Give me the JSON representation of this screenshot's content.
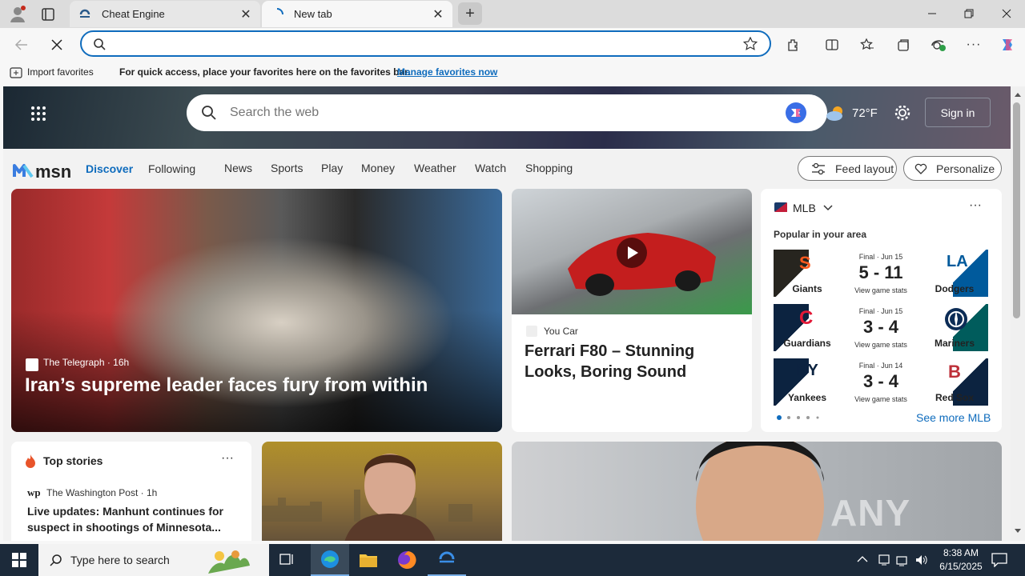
{
  "browser": {
    "tabs": [
      {
        "title": "Cheat Engine"
      },
      {
        "title": "New tab"
      }
    ],
    "address_value": "",
    "favorites_bar": {
      "import_label": "Import favorites",
      "hint": "For quick access, place your favorites here on the favorites bar.",
      "manage_link": "Manage favorites now"
    }
  },
  "msn": {
    "search_placeholder": "Search the web",
    "weather_temp": "72°F",
    "sign_in": "Sign in",
    "logo_text": "msn",
    "tabs": [
      "Discover",
      "Following"
    ],
    "nav": [
      "News",
      "Sports",
      "Play",
      "Money",
      "Weather",
      "Watch",
      "Shopping"
    ],
    "feed_layout": "Feed layout",
    "personalize": "Personalize",
    "hero_story": {
      "source": "The Telegraph",
      "age": "16h",
      "headline": "Iran’s supreme leader faces fury from within"
    },
    "video_story": {
      "source": "You Car",
      "headline": "Ferrari F80 – Stunning Looks, Boring Sound"
    },
    "mlb": {
      "title": "MLB",
      "subtitle": "Popular in your area",
      "games": [
        {
          "status": "Final · Jun 15",
          "score": "5 - 11",
          "home": "Giants",
          "away": "Dodgers",
          "link": "View game stats",
          "home_color": "#27251f",
          "away_color": "#005a9c"
        },
        {
          "status": "Final · Jun 15",
          "score": "3 - 4",
          "home": "Guardians",
          "away": "Mariners",
          "link": "View game stats",
          "home_color": "#0c2340",
          "away_color": "#005c5c"
        },
        {
          "status": "Final · Jun 14",
          "score": "3 - 4",
          "home": "Yankees",
          "away": "Red Sox",
          "link": "View game stats",
          "home_color": "#0c2340",
          "away_color": "#0c2340"
        }
      ],
      "see_more": "See more MLB"
    },
    "top_stories": {
      "title": "Top stories",
      "source": "The Washington Post",
      "age": "1h",
      "headline": "Live updates: Manhunt continues for suspect in shootings of Minnesota..."
    },
    "watermark": "ANY RUN"
  },
  "taskbar": {
    "search_placeholder": "Type here to search",
    "time": "8:38 AM",
    "date": "6/15/2025"
  },
  "colors": {
    "accent": "#0f6cbd",
    "msn_blue": "#0f6cbd"
  }
}
